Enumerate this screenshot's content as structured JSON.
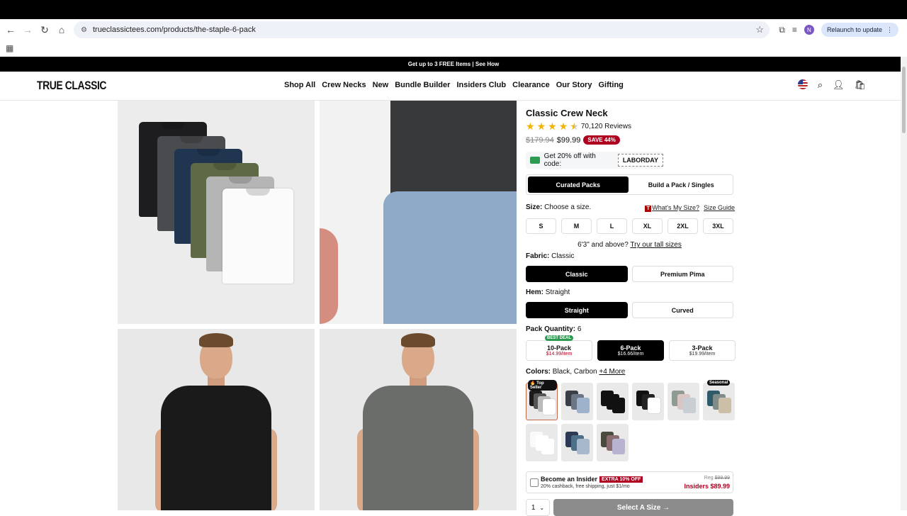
{
  "browser": {
    "url": "trueclassictees.com/products/the-staple-6-pack",
    "avatar_letter": "N",
    "relaunch_label": "Relaunch to update"
  },
  "promo": {
    "text": "Get up to 3 FREE Items | See How"
  },
  "header": {
    "logo": "TRUE CLASSIC",
    "nav": [
      "Shop All",
      "Crew Necks",
      "New",
      "Bundle Builder",
      "Insiders Club",
      "Clearance",
      "Our Story",
      "Gifting"
    ]
  },
  "product": {
    "title": "Classic Crew Neck",
    "rating": 4.5,
    "reviews": "70,120 Reviews",
    "price_was": "$179.94",
    "price_now": "$99.99",
    "save_badge": "SAVE 44%",
    "coupon_text": "Get 20% off with code:",
    "coupon_code": "LABORDAY",
    "pack_tabs": [
      "Curated Packs",
      "Build a Pack / Singles"
    ],
    "size_label": "Size:",
    "size_value": "Choose a size.",
    "whats_my_size": "What's My Size?",
    "size_guide": "Size Guide",
    "sizes": [
      "S",
      "M",
      "L",
      "XL",
      "2XL",
      "3XL"
    ],
    "tall_text": "6'3\" and above?",
    "tall_link": "Try our tall sizes",
    "fabric_label": "Fabric:",
    "fabric_value": "Classic",
    "fabrics": [
      "Classic",
      "Premium Pima"
    ],
    "hem_label": "Hem:",
    "hem_value": "Straight",
    "hems": [
      "Straight",
      "Curved"
    ],
    "pack_label": "Pack Quantity:",
    "pack_value": "6",
    "packs": [
      {
        "name": "10-Pack",
        "price": "$14.99/item",
        "badge": "BEST DEAL"
      },
      {
        "name": "6-Pack",
        "price": "$16.66/item"
      },
      {
        "name": "3-Pack",
        "price": "$19.99/item"
      }
    ],
    "colors_label": "Colors:",
    "colors_value": "Black, Carbon",
    "colors_more": "+4 More",
    "top_seller_badge": "🔥 Top Seller",
    "seasonal_badge": "Seasonal",
    "insider": {
      "title": "Become an Insider",
      "extra": "EXTRA 10% OFF",
      "sub": "20% cashback, free shipping, just $1/mo",
      "reg_label": "Reg",
      "reg_price": "$99.99",
      "insider_price": "Insiders $89.99"
    },
    "qty": "1",
    "select_button": "Select A Size →"
  }
}
